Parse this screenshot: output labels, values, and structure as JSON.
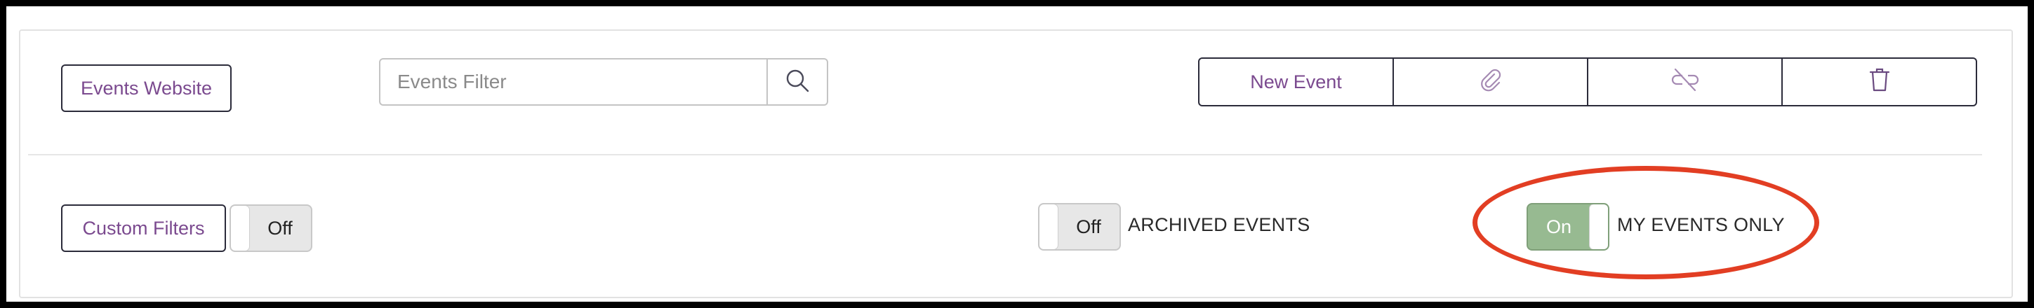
{
  "toolbar": {
    "events_website_label": "Events Website",
    "search": {
      "placeholder": "Events Filter",
      "value": ""
    },
    "actions": {
      "new_event_label": "New Event"
    }
  },
  "filters": {
    "custom_filters_label": "Custom Filters",
    "custom_filters_toggle": "Off",
    "archived_events": {
      "state": "Off",
      "label": "ARCHIVED EVENTS"
    },
    "my_events_only": {
      "state": "On",
      "label": "MY EVENTS ONLY"
    }
  },
  "colors": {
    "accent_text": "#7b4a8f",
    "toggle_on": "#97ba91",
    "highlight": "#e23e23"
  }
}
